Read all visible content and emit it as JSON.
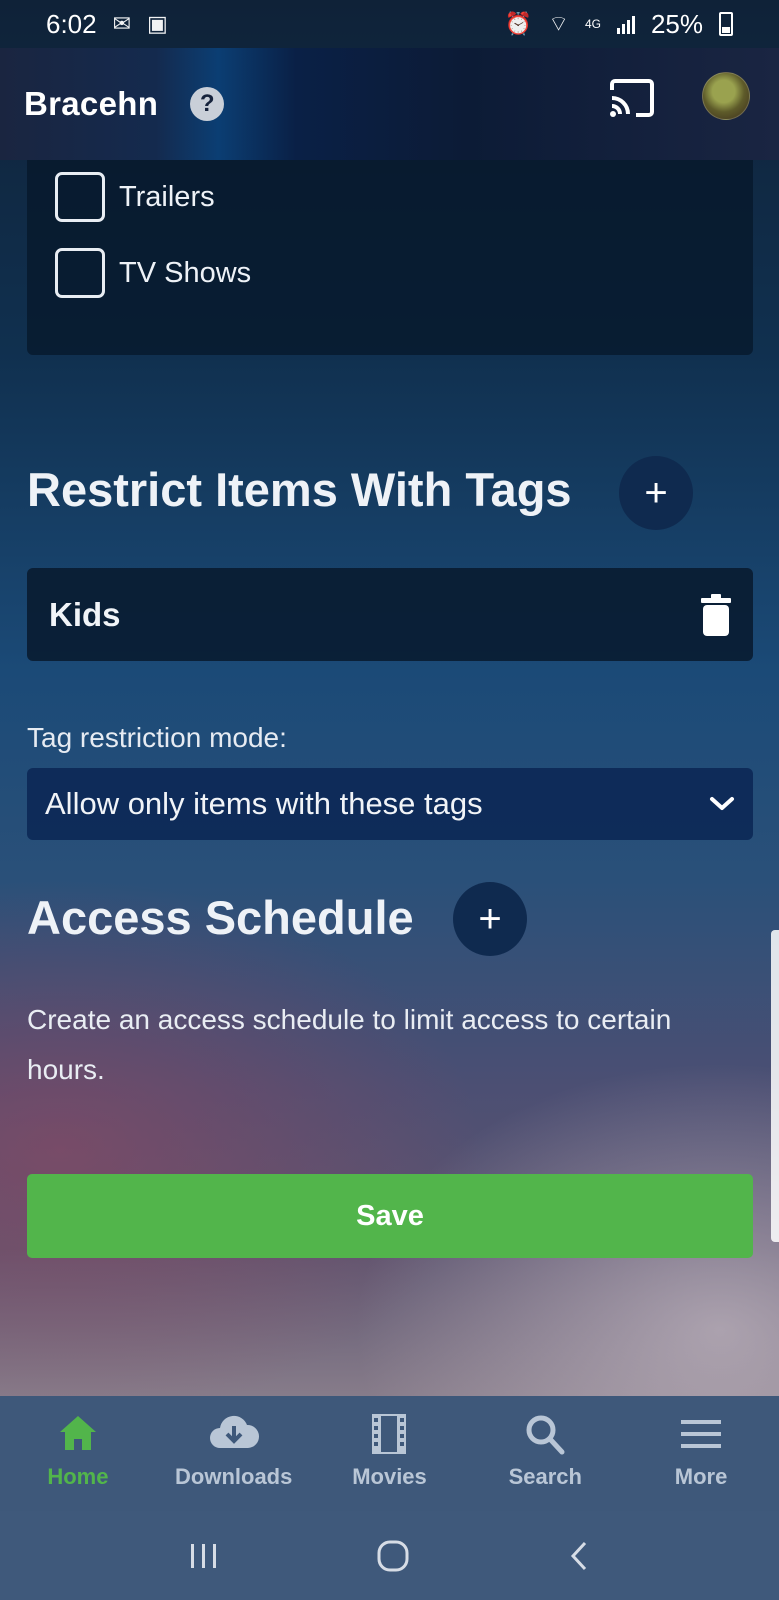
{
  "status_bar": {
    "time": "6:02",
    "battery": "25%",
    "network": "4G"
  },
  "header": {
    "title": "Bracehn",
    "help_glyph": "?"
  },
  "folders": {
    "items": [
      {
        "label": "Trailers",
        "checked": false
      },
      {
        "label": "TV Shows",
        "checked": false
      }
    ]
  },
  "restrict_tags": {
    "title": "Restrict Items With Tags",
    "add_glyph": "+",
    "tags": [
      "Kids"
    ],
    "mode_label": "Tag restriction mode:",
    "mode_value": "Allow only items with these tags"
  },
  "access_schedule": {
    "title": "Access Schedule",
    "add_glyph": "+",
    "description": "Create an access schedule to limit access to certain hours."
  },
  "save_label": "Save",
  "bottom_nav": {
    "items": [
      {
        "label": "Home",
        "icon": "home-icon",
        "active": true
      },
      {
        "label": "Downloads",
        "icon": "cloud-download-icon",
        "active": false
      },
      {
        "label": "Movies",
        "icon": "film-icon",
        "active": false
      },
      {
        "label": "Search",
        "icon": "search-icon",
        "active": false
      },
      {
        "label": "More",
        "icon": "menu-icon",
        "active": false
      }
    ]
  },
  "colors": {
    "accent": "#52b54b",
    "header_bg": "#0c1b36",
    "nav_bg": "#3e587a"
  }
}
